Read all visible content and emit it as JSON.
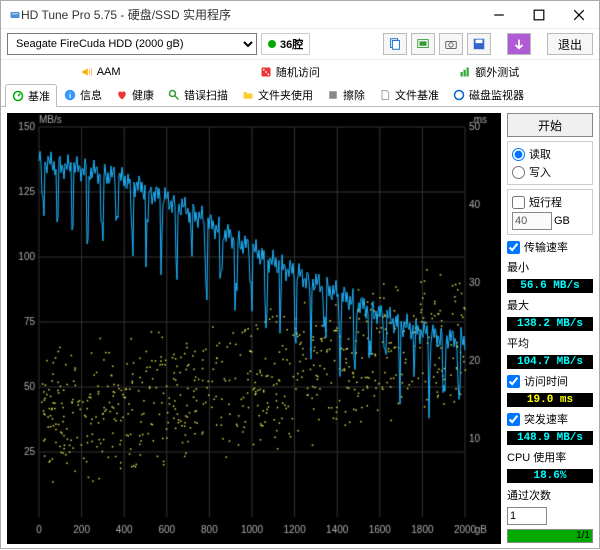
{
  "window": {
    "title": "HD Tune Pro 5.75 - 硬盘/SSD 实用程序"
  },
  "toolbar": {
    "drive": "Seagate FireCuda HDD (2000 gB)",
    "temp": "36腔",
    "exit": "退出"
  },
  "row2": {
    "aam": "AAM",
    "random": "随机访问",
    "extra": "额外测试"
  },
  "tabs": {
    "benchmark": "基准",
    "info": "信息",
    "health": "健康",
    "errorscan": "错误扫描",
    "folder": "文件夹使用",
    "erase": "擦除",
    "filebench": "文件基准",
    "monitor": "磁盘监视器"
  },
  "side": {
    "start": "开始",
    "read": "读取",
    "write": "写入",
    "shortstroke": "短行程",
    "shortval": "40",
    "gb": "GB",
    "transferrate": "传输速率",
    "min": "最小",
    "minval": "56.6 MB/s",
    "max": "最大",
    "maxval": "138.2 MB/s",
    "avg": "平均",
    "avgval": "104.7 MB/s",
    "access": "访问时间",
    "accessval": "19.0 ms",
    "burst": "突发速率",
    "burstval": "148.9 MB/s",
    "cpu": "CPU 使用率",
    "cpuval": "18.6%",
    "passes": "通过次数",
    "passesval": "1",
    "progress": "1/1"
  },
  "chart_data": {
    "type": "line",
    "title": "",
    "xlabel": "gB",
    "ylabel_left": "MB/s",
    "ylabel_right": "ms",
    "xlim": [
      0,
      2000
    ],
    "ylim_left": [
      0,
      150
    ],
    "ylim_right": [
      0,
      50
    ],
    "x_ticks": [
      0,
      200,
      400,
      600,
      800,
      1000,
      1200,
      1400,
      1600,
      1800,
      2000
    ],
    "y_ticks_left": [
      25,
      50,
      75,
      100,
      125,
      150
    ],
    "y_ticks_right": [
      10,
      20,
      30,
      40,
      50
    ],
    "series": [
      {
        "name": "transfer_rate_MBs",
        "axis": "left",
        "color": "#1fb6ff",
        "x": [
          0,
          100,
          200,
          300,
          400,
          500,
          600,
          700,
          800,
          900,
          1000,
          1100,
          1200,
          1300,
          1400,
          1500,
          1600,
          1700,
          1800,
          1900,
          2000
        ],
        "values": [
          137,
          135,
          134,
          132,
          130,
          126,
          122,
          118,
          113,
          108,
          103,
          98,
          94,
          90,
          86,
          82,
          78,
          74,
          71,
          69,
          68
        ]
      },
      {
        "name": "access_time_ms",
        "axis": "right",
        "color": "#d8d850",
        "type": "scatter",
        "note": "approx cloud; center rises from ~12ms at 0gB to ~23ms at 2000gB, spread ±8ms",
        "x": [
          0,
          500,
          1000,
          1500,
          2000
        ],
        "values": [
          12,
          15,
          18,
          21,
          23
        ]
      }
    ]
  }
}
